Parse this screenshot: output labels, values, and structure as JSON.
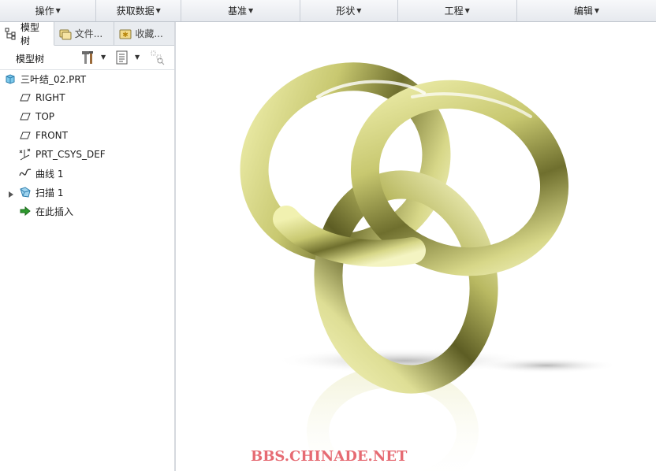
{
  "ribbon": {
    "groups": [
      "操作",
      "获取数据",
      "基准",
      "形状",
      "工程",
      "编辑"
    ]
  },
  "panel": {
    "tabs": [
      "模型树",
      "文件...",
      "收藏..."
    ],
    "toolbar_title": "模型树",
    "tree": [
      {
        "label": "三叶结_02.PRT",
        "icon": "part-icon"
      },
      {
        "label": "RIGHT",
        "icon": "datum-plane-icon"
      },
      {
        "label": "TOP",
        "icon": "datum-plane-icon"
      },
      {
        "label": "FRONT",
        "icon": "datum-plane-icon"
      },
      {
        "label": "PRT_CSYS_DEF",
        "icon": "coordinate-system-icon"
      },
      {
        "label": "曲线 1",
        "icon": "curve-icon"
      },
      {
        "label": "扫描 1",
        "icon": "sweep-icon"
      },
      {
        "label": "在此插入",
        "icon": "insert-here-arrow-icon"
      }
    ]
  },
  "viewport": {
    "model": "trefoil-knot",
    "model_color": "#d8d88a",
    "watermark": "BBS.CHINADE.NET",
    "watermark_color": "#e66b73"
  }
}
